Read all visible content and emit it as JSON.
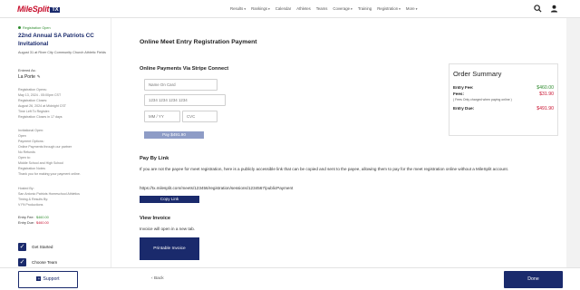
{
  "brand": {
    "name": "MileSplit",
    "badge": "TX"
  },
  "nav": [
    {
      "label": "Results",
      "caret": true
    },
    {
      "label": "Rankings",
      "caret": true
    },
    {
      "label": "Calendar",
      "caret": false
    },
    {
      "label": "Athletes",
      "caret": false
    },
    {
      "label": "Teams",
      "caret": false
    },
    {
      "label": "Coverage",
      "caret": true
    },
    {
      "label": "Training",
      "caret": false
    },
    {
      "label": "Registration",
      "caret": true
    },
    {
      "label": "More",
      "caret": true
    }
  ],
  "sidebar": {
    "status": "Registration Open",
    "title": "22nd Annual SA Patriots CC Invitational",
    "date_location": "August 31 at River City Community Church Athletic Fields",
    "entered_as_label": "Entered As:",
    "entered_as": "La Porte",
    "reg_opens_label": "Registration Opens:",
    "reg_opens": "May 13, 2024 - 05:00pm CST",
    "reg_closes_label": "Registration Closes:",
    "reg_closes": "August 26, 2024 at Midnight CST",
    "time_left_label": "Time Left To Register:",
    "time_left": "Registration Closes in 17 days",
    "inv_open_label": "Invitational Open:",
    "inv_open": "Open",
    "payment_label": "Payment Options:",
    "payment": "Online Payments through our partner",
    "refunds": "No Refunds",
    "open_to_label": "Open to:",
    "open_to": "Middle School and High School",
    "notes_label": "Registration Notes:",
    "notes": "Thank you for making your payment online.",
    "hosted_label": "Hosted By:",
    "hosted": "San Antonio Patriots Homeschool Athletics",
    "timing_label": "Timing & Results By:",
    "timing": "V Fit Productions",
    "entry_fee_label": "Entry Fee:",
    "entry_fee": "$460.00",
    "entry_due_label": "Entry Due:",
    "entry_due": "$460.00",
    "steps": [
      {
        "label": "Get Started"
      },
      {
        "label": "Choose Team"
      }
    ]
  },
  "main": {
    "title": "Online Meet Entry Registration Payment",
    "stripe_heading": "Online Payments Via Stripe Connect",
    "name_placeholder": "Name On Card",
    "card_placeholder": "1234 1234 1234 1234",
    "exp_placeholder": "MM / YY",
    "cvc_placeholder": "CVC",
    "pay_button": "Pay $491.90",
    "paybylink_heading": "Pay By Link",
    "paybylink_text": "If you are not the payee for meet registration, here is a publicly accessible link that can be copied and sent to the payee, allowing them to pay for the meet registration online without a MileSplit account.",
    "link_url": "https://tx.milesplit.com/meets/123456/registration/sessions/1234567/publicPayment",
    "copy_button": "Copy Link",
    "invoice_heading": "View Invoice",
    "invoice_text": "Invoice will open in a new tab.",
    "print_button": "Printable Invoice"
  },
  "summary": {
    "title": "Order Summary",
    "entry_fee_label": "Entry Fee:",
    "entry_fee": "$460.00",
    "fees_label": "Fees:",
    "fees": "$31.90",
    "fees_note": "( Fees Only charged when paying online )",
    "entry_due_label": "Entry Due:",
    "entry_due": "$491.90"
  },
  "footer": {
    "support": "Support",
    "back": "Back",
    "done": "Done"
  },
  "colors": {
    "brand_navy": "#1a2a6c",
    "brand_red": "#c8102e",
    "green": "#2e8b2e"
  },
  "icons": [
    "search-icon",
    "user-icon",
    "pencil-icon",
    "check-icon",
    "chevron-left-icon",
    "plus-box-icon"
  ]
}
